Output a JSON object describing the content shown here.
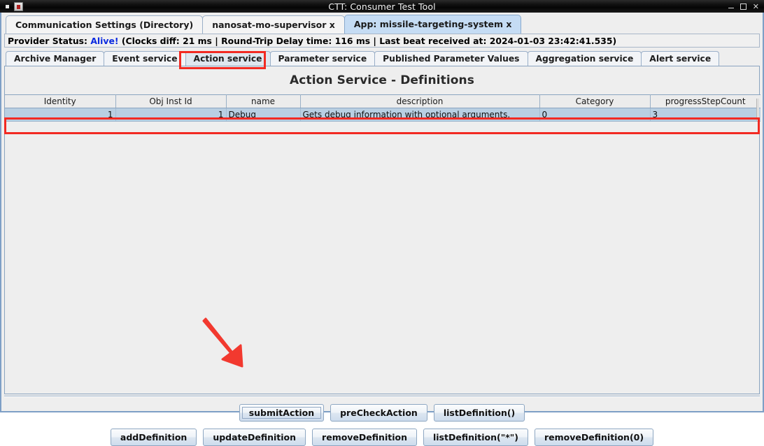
{
  "window": {
    "title": "CTT: Consumer Test Tool",
    "icon": "app-icon",
    "controls": {
      "minimize": "–",
      "maximize": "□",
      "close": "✕"
    }
  },
  "main_tabs": [
    {
      "label": "Communication Settings (Directory)",
      "selected": false
    },
    {
      "label": "nanosat-mo-supervisor x",
      "selected": false
    },
    {
      "label": "App: missile-targeting-system x",
      "selected": true
    }
  ],
  "status": {
    "prefix": "Provider Status: ",
    "state": "Alive!",
    "details": " (Clocks diff: 21 ms | Round-Trip Delay time: 116 ms | Last beat received at: 2024-01-03 23:42:41.535)",
    "state_color": "#0b2ae0"
  },
  "service_tabs": [
    {
      "label": "Archive Manager",
      "selected": false
    },
    {
      "label": "Event service",
      "selected": false
    },
    {
      "label": "Action service",
      "selected": true
    },
    {
      "label": "Parameter service",
      "selected": false
    },
    {
      "label": "Published Parameter Values",
      "selected": false
    },
    {
      "label": "Aggregation service",
      "selected": false
    },
    {
      "label": "Alert service",
      "selected": false
    }
  ],
  "panel": {
    "title": "Action Service - Definitions",
    "table": {
      "columns": [
        "Identity",
        "Obj Inst Id",
        "name",
        "description",
        "Category",
        "progressStepCount"
      ],
      "rows": [
        {
          "Identity": "1",
          "Obj Inst Id": "1",
          "name": "Debug",
          "description": "Gets debug information with optional arguments.",
          "Category": "0",
          "progressStepCount": "3",
          "selected": true
        }
      ]
    }
  },
  "buttons": {
    "row1": [
      {
        "label": "submitAction",
        "focused": true
      },
      {
        "label": "preCheckAction",
        "focused": false
      },
      {
        "label": "listDefinition()",
        "focused": false
      }
    ],
    "row2": [
      {
        "label": "addDefinition",
        "focused": false
      },
      {
        "label": "updateDefinition",
        "focused": false
      },
      {
        "label": "removeDefinition",
        "focused": false
      },
      {
        "label": "listDefinition(\"*\")",
        "focused": false
      },
      {
        "label": "removeDefinition(0)",
        "focused": false
      }
    ]
  },
  "annotations": {
    "color": "#f22a22",
    "highlight_tab": "Action service",
    "highlight_row": "Debug definition row",
    "arrow_target": "submitAction"
  }
}
